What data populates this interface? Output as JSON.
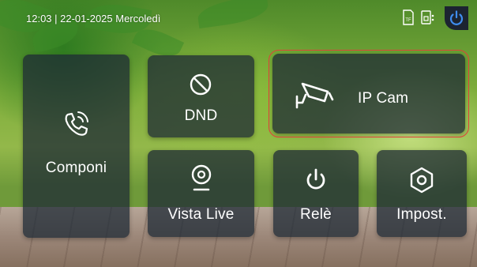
{
  "status_bar": {
    "datetime": "12:03 | 22-01-2025 Mercoledì",
    "icons": [
      "tf-card-icon",
      "sd-card-icon"
    ],
    "power_icon": "power-icon"
  },
  "tiles": {
    "componi": {
      "label": "Componi",
      "icon": "phone-call-icon"
    },
    "dnd": {
      "label": "DND",
      "icon": "do-not-disturb-icon"
    },
    "ipcam": {
      "label": "IP Cam",
      "icon": "security-camera-icon",
      "selected": true
    },
    "vista_live": {
      "label": "Vista Live",
      "icon": "webcam-icon"
    },
    "rele": {
      "label": "Relè",
      "icon": "power-icon"
    },
    "impost": {
      "label": "Impost.",
      "icon": "settings-hexagon-icon"
    }
  },
  "colors": {
    "tile_bg": "#1c2834",
    "selection_outline": "#e0403a",
    "text": "#ffffff"
  }
}
